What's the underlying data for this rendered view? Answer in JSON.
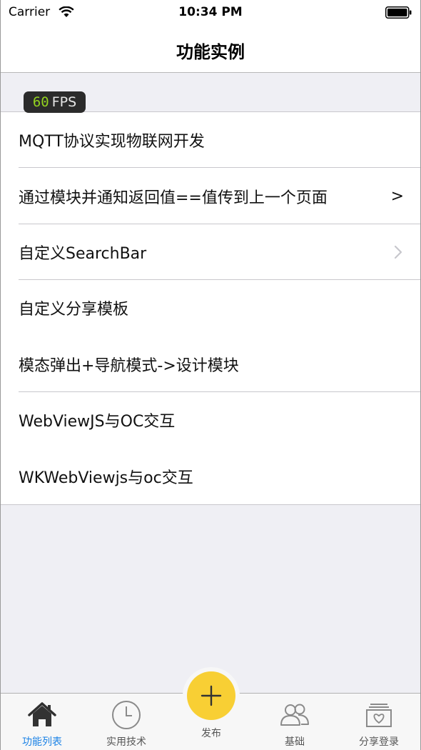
{
  "status_bar": {
    "carrier": "Carrier",
    "time": "10:34 PM"
  },
  "nav": {
    "title": "功能实例"
  },
  "fps": {
    "value": "60",
    "label": "FPS"
  },
  "list": {
    "items": [
      {
        "label": "MQTT协议实现物联网开发"
      },
      {
        "label": "通过模块并通知返回值==值传到上一个页面",
        "accessory": ">"
      },
      {
        "label": "自定义SearchBar"
      },
      {
        "label": "自定义分享模板"
      },
      {
        "label": "模态弹出+导航模式->设计模块"
      },
      {
        "label": "WebViewJS与OC交互"
      },
      {
        "label": "WKWebViewjs与oc交互"
      }
    ]
  },
  "tab_bar": {
    "tabs": [
      {
        "label": "功能列表",
        "icon": "home-icon",
        "active": true
      },
      {
        "label": "实用技术",
        "icon": "clock-icon"
      },
      {
        "label": "发布",
        "icon": "plus-icon"
      },
      {
        "label": "基础",
        "icon": "people-icon"
      },
      {
        "label": "分享登录",
        "icon": "gift-box-icon"
      }
    ]
  },
  "colors": {
    "accent": "#1b82e6",
    "publish": "#f8cf34",
    "fps_green": "#93d21f",
    "background": "#efeff4"
  }
}
